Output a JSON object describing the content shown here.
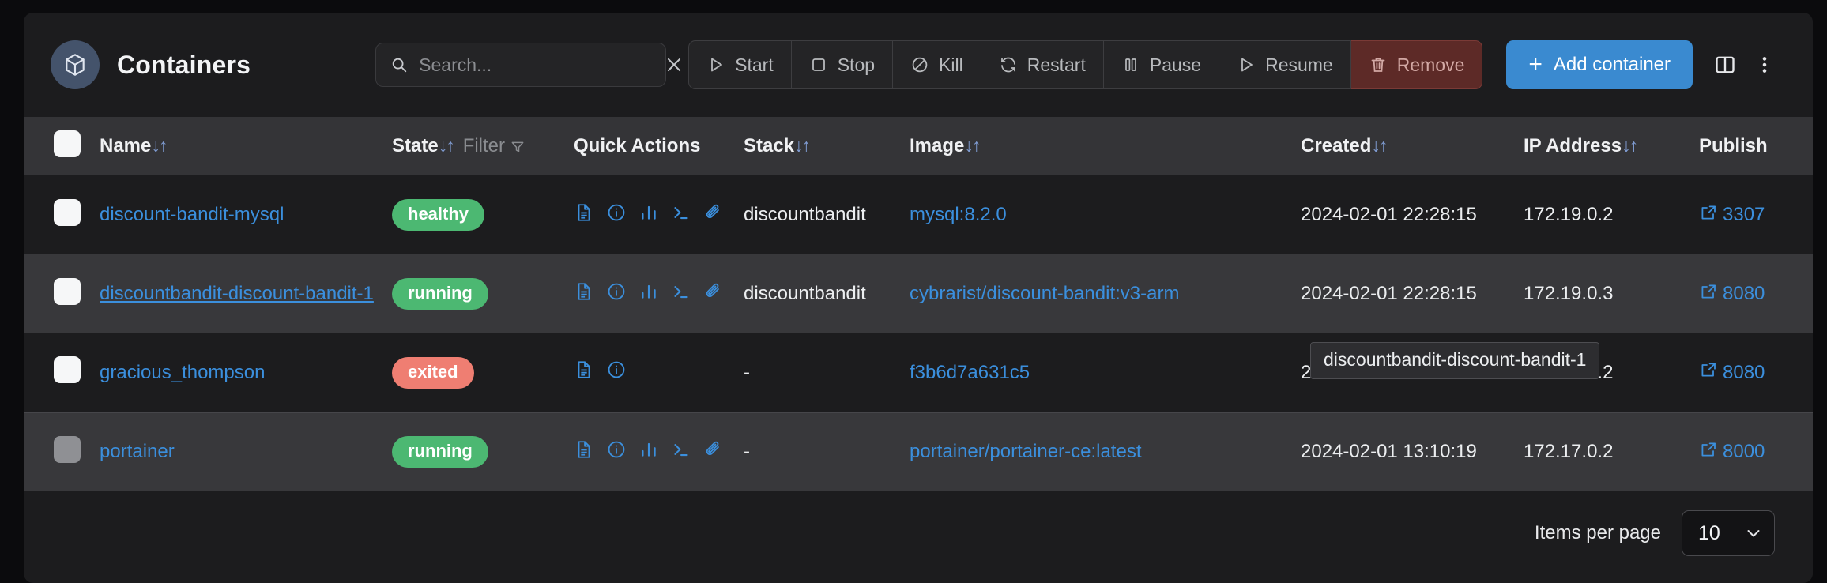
{
  "header": {
    "title": "Containers",
    "title_icon": "cube-icon",
    "search": {
      "placeholder": "Search...",
      "value": "",
      "icon": "search-icon",
      "clear_icon": "close-icon"
    },
    "actions": [
      {
        "label": "Start",
        "icon": "play-icon",
        "variant": "default"
      },
      {
        "label": "Stop",
        "icon": "square-icon",
        "variant": "default"
      },
      {
        "label": "Kill",
        "icon": "ban-icon",
        "variant": "default"
      },
      {
        "label": "Restart",
        "icon": "refresh-icon",
        "variant": "default"
      },
      {
        "label": "Pause",
        "icon": "pause-icon",
        "variant": "default"
      },
      {
        "label": "Resume",
        "icon": "play-icon",
        "variant": "default"
      },
      {
        "label": "Remove",
        "icon": "trash-icon",
        "variant": "danger"
      }
    ],
    "add_button": {
      "label": "Add container",
      "icon": "plus-icon"
    },
    "panel_toggle_icon": "columns-layout-icon",
    "overflow_icon": "kebab-menu-icon"
  },
  "table": {
    "columns": [
      {
        "key": "checkbox",
        "label": "",
        "sortable": false
      },
      {
        "key": "name",
        "label": "Name",
        "sortable": true
      },
      {
        "key": "state",
        "label": "State",
        "sortable": true,
        "filter_label": "Filter",
        "filter_icon": "funnel-icon"
      },
      {
        "key": "quick",
        "label": "Quick Actions",
        "sortable": false
      },
      {
        "key": "stack",
        "label": "Stack",
        "sortable": true
      },
      {
        "key": "image",
        "label": "Image",
        "sortable": true
      },
      {
        "key": "created",
        "label": "Created",
        "sortable": true
      },
      {
        "key": "ip",
        "label": "IP Address",
        "sortable": true
      },
      {
        "key": "published",
        "label": "Publish",
        "sortable": false
      }
    ],
    "sort_glyph": "↓↑",
    "rows": [
      {
        "checked": false,
        "checkbox_disabled": false,
        "name": "discount-bandit-mysql",
        "name_underlined": false,
        "state": "healthy",
        "state_color": "green",
        "quick_actions": [
          "logs-icon",
          "info-icon",
          "stats-icon",
          "console-icon",
          "attach-icon"
        ],
        "stack": "discountbandit",
        "image": "mysql:8.2.0",
        "created": "2024-02-01 22:28:15",
        "ip": "172.19.0.2",
        "published": "3307",
        "published_icon": "external-link-icon"
      },
      {
        "checked": false,
        "checkbox_disabled": false,
        "name": "discountbandit-discount-bandit-1",
        "name_underlined": true,
        "state": "running",
        "state_color": "green",
        "quick_actions": [
          "logs-icon",
          "info-icon",
          "stats-icon",
          "console-icon",
          "attach-icon"
        ],
        "stack": "discountbandit",
        "image": "cybrarist/discount-bandit:v3-arm",
        "created": "2024-02-01 22:28:15",
        "ip": "172.19.0.3",
        "published": "8080",
        "published_icon": "external-link-icon"
      },
      {
        "checked": false,
        "checkbox_disabled": false,
        "name": "gracious_thompson",
        "name_underlined": false,
        "state": "exited",
        "state_color": "red",
        "quick_actions": [
          "logs-icon",
          "info-icon"
        ],
        "stack": "-",
        "image": "f3b6d7a631c5",
        "created": "2024-01-24 11:09:01",
        "ip": "172.17.0.2",
        "published": "8080",
        "published_icon": "external-link-icon"
      },
      {
        "checked": false,
        "checkbox_disabled": true,
        "name": "portainer",
        "name_underlined": false,
        "state": "running",
        "state_color": "green",
        "quick_actions": [
          "logs-icon",
          "info-icon",
          "stats-icon",
          "console-icon",
          "attach-icon"
        ],
        "stack": "-",
        "image": "portainer/portainer-ce:latest",
        "created": "2024-02-01 13:10:19",
        "ip": "172.17.0.2",
        "published": "8000",
        "published_icon": "external-link-icon"
      }
    ]
  },
  "tooltip": {
    "text": "discountbandit-discount-bandit-1"
  },
  "footer": {
    "items_per_page_label": "Items per page",
    "items_per_page_value": "10",
    "chevron_icon": "chevron-down-icon"
  },
  "colors": {
    "accent": "#3a8ad0",
    "link": "#3b8fdd",
    "green": "#4cb872",
    "red": "#ef7e72",
    "danger_bg": "#5d2a27",
    "panel_bg": "#1c1c1e",
    "row_alt_bg": "#38383b",
    "header_bg": "#343437"
  }
}
